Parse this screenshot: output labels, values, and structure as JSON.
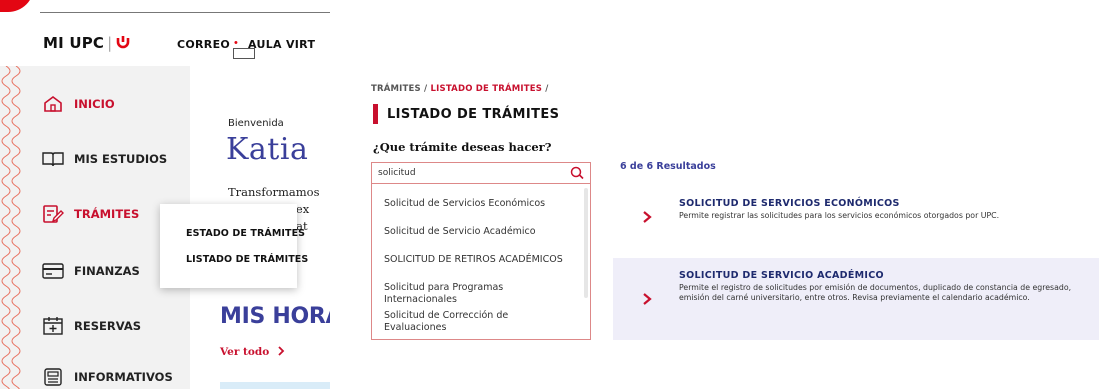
{
  "left_app": {
    "brand": "MI UPC",
    "top_links": {
      "correo": "CORREO",
      "aula": "AULA VIRT"
    },
    "sidebar": {
      "items": [
        {
          "label": "INICIO",
          "icon": "home-icon"
        },
        {
          "label": "MIS ESTUDIOS",
          "icon": "book-icon"
        },
        {
          "label": "TRÁMITES",
          "icon": "document-edit-icon",
          "active": true
        },
        {
          "label": "FINANZAS",
          "icon": "card-icon"
        },
        {
          "label": "RESERVAS",
          "icon": "calendar-plus-icon"
        },
        {
          "label": "INFORMATIVOS",
          "icon": "news-icon"
        }
      ]
    },
    "dropdown": {
      "items": [
        "ESTADO DE TRÁMITES",
        "LISTADO DE TRÁMITES"
      ]
    },
    "welcome": {
      "greeting": "Bienvenida",
      "name": "Katia",
      "text_line1": "Transformamos",
      "text_line2": "na ex",
      "text_line3": "y at"
    },
    "schedule": {
      "title": "MIS HORAR",
      "see_all": "Ver todo"
    },
    "colors": {
      "brand_red": "#e30613",
      "accent_red": "#c8102e",
      "indigo": "#3a3f9a",
      "sidebar_bg": "#f2f2f2"
    }
  },
  "right_app": {
    "breadcrumb": {
      "root": "TRÁMITES",
      "sep": "/",
      "current": "LISTADO DE TRÁMITES",
      "trailing": "/"
    },
    "page_title": "LISTADO DE TRÁMITES",
    "question": "¿Que trámite deseas hacer?",
    "search": {
      "value": "solicitud",
      "icon": "search-icon"
    },
    "suggestions": [
      "Solicitud de Servicios Económicos",
      "Solicitud de Servicio Académico",
      "SOLICITUD DE RETIROS ACADÉMICOS",
      "Solicitud para Programas Internacionales",
      "Solicitud de Corrección de Evaluaciones"
    ],
    "results_count": "6 de 6 Resultados",
    "results": [
      {
        "title": "SOLICITUD DE SERVICIOS ECONÓMICOS",
        "description": "Permite registrar las solicitudes para los servicios económicos otorgados por UPC."
      },
      {
        "title": "SOLICITUD DE SERVICIO ACADÉMICO",
        "description": "Permite el registro de solicitudes por emisión de documentos, duplicado de constancia de egresado, emisión del carné universitario, entre otros. Revisa previamente el calendario académico."
      }
    ],
    "colors": {
      "result_highlight_bg": "#efeef9",
      "title_navy": "#1e2a6e",
      "chevron_red": "#c8102e"
    }
  }
}
